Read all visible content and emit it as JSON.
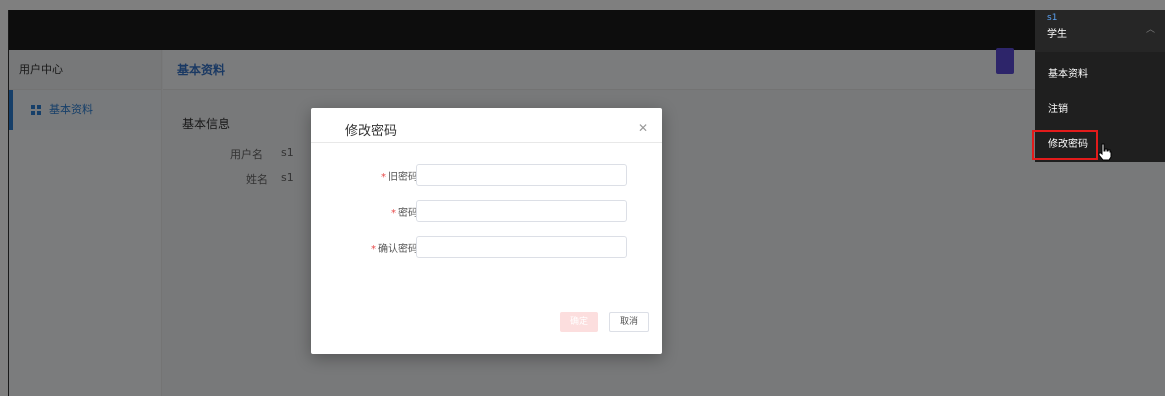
{
  "sidebar": {
    "heading": "用户中心",
    "items": [
      {
        "label": "基本资料"
      }
    ]
  },
  "main": {
    "heading": "基本资料",
    "section_title": "基本信息",
    "rows": [
      {
        "label": "用户名",
        "value": "s1"
      },
      {
        "label": "姓名",
        "value": "s1"
      }
    ]
  },
  "modal": {
    "title": "修改密码",
    "close_icon": "close-icon",
    "fields": [
      {
        "label": "旧密码",
        "required": true,
        "value": "",
        "placeholder": ""
      },
      {
        "label": "密码",
        "required": true,
        "value": "",
        "placeholder": ""
      },
      {
        "label": "确认密码",
        "required": true,
        "value": "",
        "placeholder": ""
      }
    ],
    "ok_label": "确定",
    "cancel_label": "取消"
  },
  "user_menu": {
    "user_id": "s1",
    "role": "学生",
    "items": [
      {
        "label": "基本资料"
      },
      {
        "label": "注销"
      },
      {
        "label": "修改密码"
      }
    ]
  },
  "colors": {
    "accent": "#2d7fd3",
    "highlight_border": "#e31b1b",
    "required_star": "#e84a4a",
    "topbar": "#1a1a1a"
  }
}
